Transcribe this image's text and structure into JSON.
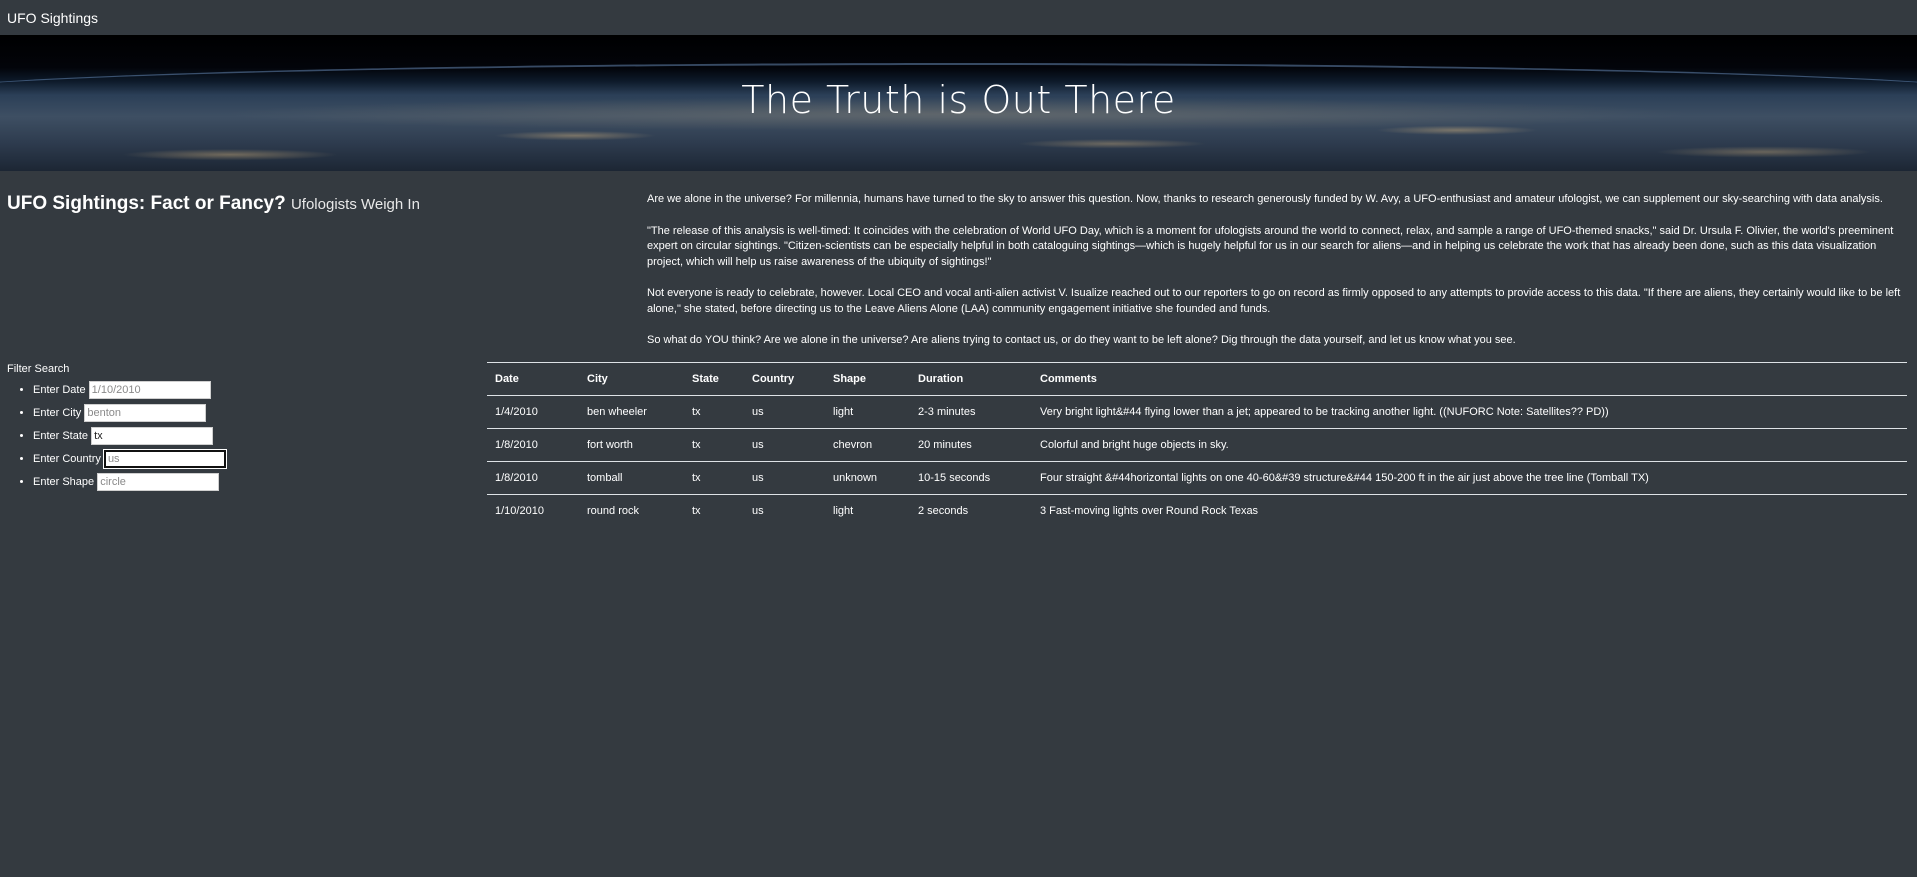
{
  "nav": {
    "brand": "UFO Sightings"
  },
  "hero": {
    "title": "The Truth is Out There"
  },
  "intro": {
    "heading": "UFO Sightings: Fact or Fancy?",
    "subheading": "Ufologists Weigh In"
  },
  "article": {
    "paragraphs": [
      "Are we alone in the universe? For millennia, humans have turned to the sky to answer this question. Now, thanks to research generously funded by W. Avy, a UFO-enthusiast and amateur ufologist, we can supplement our sky-searching with data analysis.",
      "\"The release of this analysis is well-timed: It coincides with the celebration of World UFO Day, which is a moment for ufologists around the world to connect, relax, and sample a range of UFO-themed snacks,\" said Dr. Ursula F. Olivier, the world's preeminent expert on circular sightings. \"Citizen-scientists can be especially helpful in both cataloguing sightings—which is hugely helpful for us in our search for aliens—and in helping us celebrate the work that has already been done, such as this data visualization project, which will help us raise awareness of the ubiquity of sightings!\"",
      "Not everyone is ready to celebrate, however. Local CEO and vocal anti-alien activist V. Isualize reached out to our reporters to go on record as firmly opposed to any attempts to provide access to this data. \"If there are aliens, they certainly would like to be left alone,\" she stated, before directing us to the Leave Aliens Alone (LAA) community engagement initiative she founded and funds.",
      "So what do YOU think? Are we alone in the universe? Are aliens trying to contact us, or do they want to be left alone? Dig through the data yourself, and let us know what you see."
    ]
  },
  "filters": {
    "title": "Filter Search",
    "items": [
      {
        "label": "Enter Date",
        "placeholder": "1/10/2010",
        "value": ""
      },
      {
        "label": "Enter City",
        "placeholder": "benton",
        "value": ""
      },
      {
        "label": "Enter State",
        "placeholder": "",
        "value": "tx"
      },
      {
        "label": "Enter Country",
        "placeholder": "us",
        "value": ""
      },
      {
        "label": "Enter Shape",
        "placeholder": "circle",
        "value": ""
      }
    ]
  },
  "table": {
    "columns": [
      "Date",
      "City",
      "State",
      "Country",
      "Shape",
      "Duration",
      "Comments"
    ],
    "rows": [
      [
        "1/4/2010",
        "ben wheeler",
        "tx",
        "us",
        "light",
        "2-3 minutes",
        "Very bright light&#44 flying lower than a jet; appeared to be tracking another light. ((NUFORC Note: Satellites?? PD))"
      ],
      [
        "1/8/2010",
        "fort worth",
        "tx",
        "us",
        "chevron",
        "20 minutes",
        "Colorful and bright huge objects in sky."
      ],
      [
        "1/8/2010",
        "tomball",
        "tx",
        "us",
        "unknown",
        "10-15 seconds",
        "Four straight &#44horizontal lights on one 40-60&#39 structure&#44 150-200 ft in the air just above the tree line (Tomball TX)"
      ],
      [
        "1/10/2010",
        "round rock",
        "tx",
        "us",
        "light",
        "2 seconds",
        "3 Fast-moving lights over Round Rock Texas"
      ]
    ]
  }
}
